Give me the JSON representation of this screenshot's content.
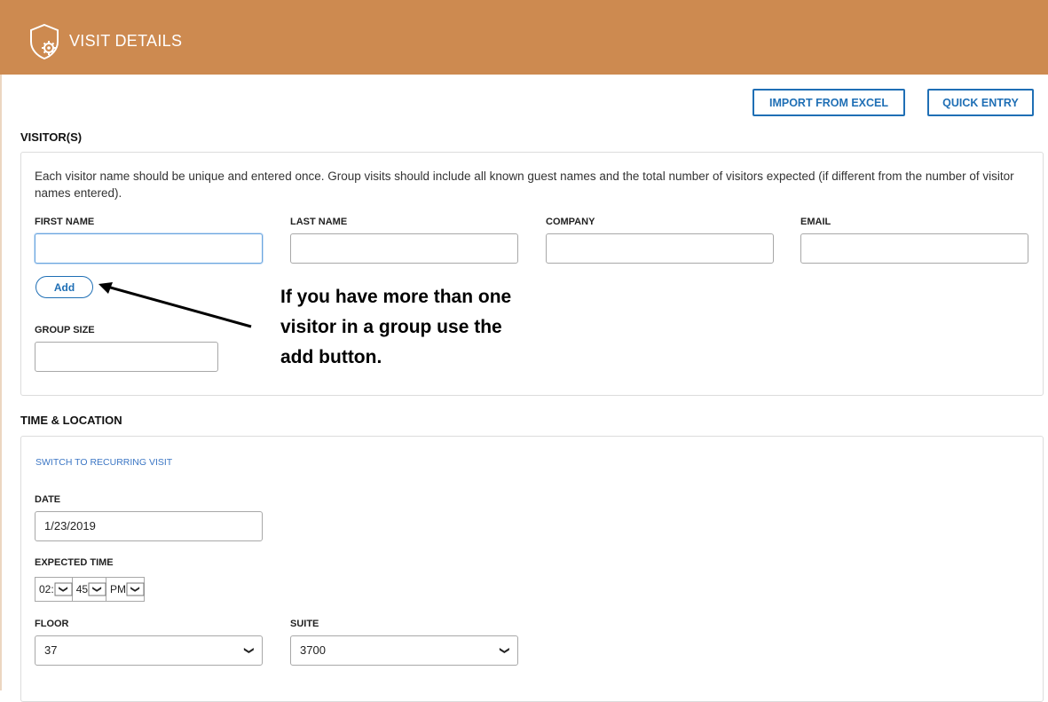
{
  "header": {
    "title": "VISIT DETAILS",
    "icon": "shield-gear-icon",
    "color": "#cd8a50"
  },
  "toolbar": {
    "import_label": "IMPORT FROM EXCEL",
    "quick_label": "QUICK ENTRY"
  },
  "visitors": {
    "section_title": "VISITOR(S)",
    "note": "Each visitor name should be unique and entered once. Group visits should include all known guest names and the total number of visitors expected (if different from the number of visitor names entered).",
    "first_name_label": "FIRST NAME",
    "last_name_label": "LAST NAME",
    "company_label": "COMPANY",
    "email_label": "EMAIL",
    "first_name_value": "",
    "last_name_value": "",
    "company_value": "",
    "email_value": "",
    "add_label": "Add",
    "group_size_label": "GROUP SIZE",
    "group_size_value": "",
    "annotation_line1": "If you have more than one",
    "annotation_line2": "visitor in a group use the",
    "annotation_line3": "add button."
  },
  "time_location": {
    "section_title": "TIME & LOCATION",
    "switch_label": "SWITCH TO RECURRING VISIT",
    "date_label": "DATE",
    "date_value": "1/23/2019",
    "expected_time_label": "EXPECTED TIME",
    "hour": "02:",
    "minute": "45",
    "ampm": "PM",
    "floor_label": "FLOOR",
    "floor_value": "37",
    "suite_label": "SUITE",
    "suite_value": "3700"
  }
}
